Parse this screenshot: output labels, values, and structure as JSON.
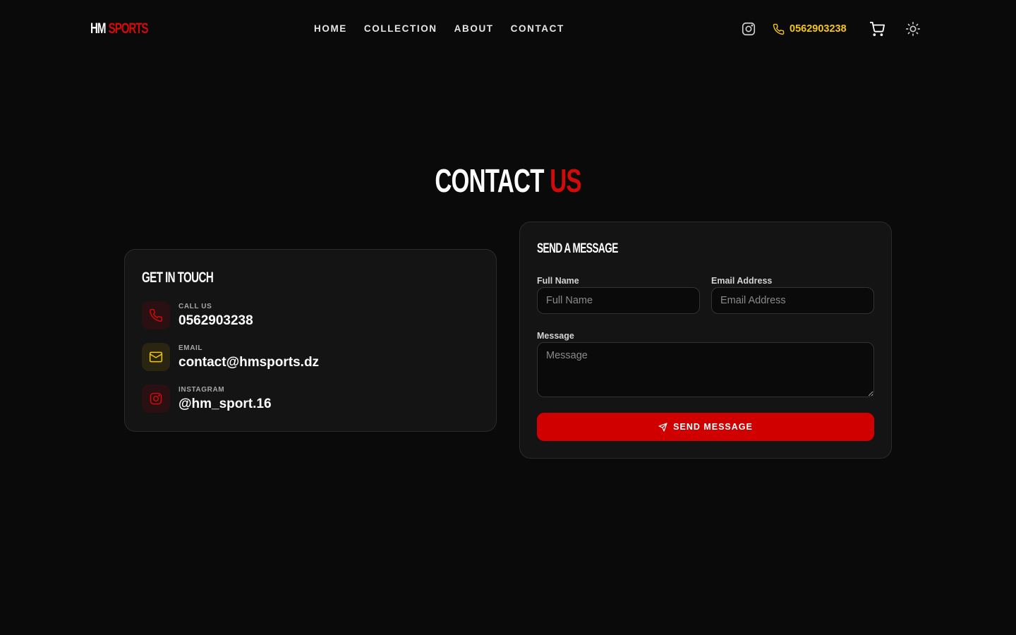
{
  "brand": {
    "part1": "HM",
    "part2": "SPORTS"
  },
  "nav": {
    "items": [
      {
        "label": "HOME"
      },
      {
        "label": "COLLECTION"
      },
      {
        "label": "ABOUT"
      },
      {
        "label": "CONTACT"
      }
    ]
  },
  "header": {
    "phone": "0562903238",
    "icons": [
      "instagram-icon",
      "phone-icon",
      "cart-icon",
      "sun-icon"
    ]
  },
  "title": {
    "word1": "CONTACT",
    "word2": "US"
  },
  "info_card": {
    "heading": "GET IN TOUCH",
    "items": [
      {
        "label": "CALL US",
        "value": "0562903238",
        "icon": "phone-icon"
      },
      {
        "label": "EMAIL",
        "value": "contact@hmsports.dz",
        "icon": "mail-icon"
      },
      {
        "label": "INSTAGRAM",
        "value": "@hm_sport.16",
        "icon": "instagram-icon"
      }
    ]
  },
  "form": {
    "heading": "SEND A MESSAGE",
    "full_name": {
      "label": "Full Name",
      "placeholder": "Full Name",
      "value": ""
    },
    "email": {
      "label": "Email Address",
      "placeholder": "Email Address",
      "value": ""
    },
    "message": {
      "label": "Message",
      "placeholder": "Message",
      "value": ""
    },
    "submit_label": "SEND MESSAGE"
  },
  "colors": {
    "background": "#0a0a0a",
    "card": "#141414",
    "accent_red": "#d10000",
    "accent_yellow": "#f5c518"
  }
}
